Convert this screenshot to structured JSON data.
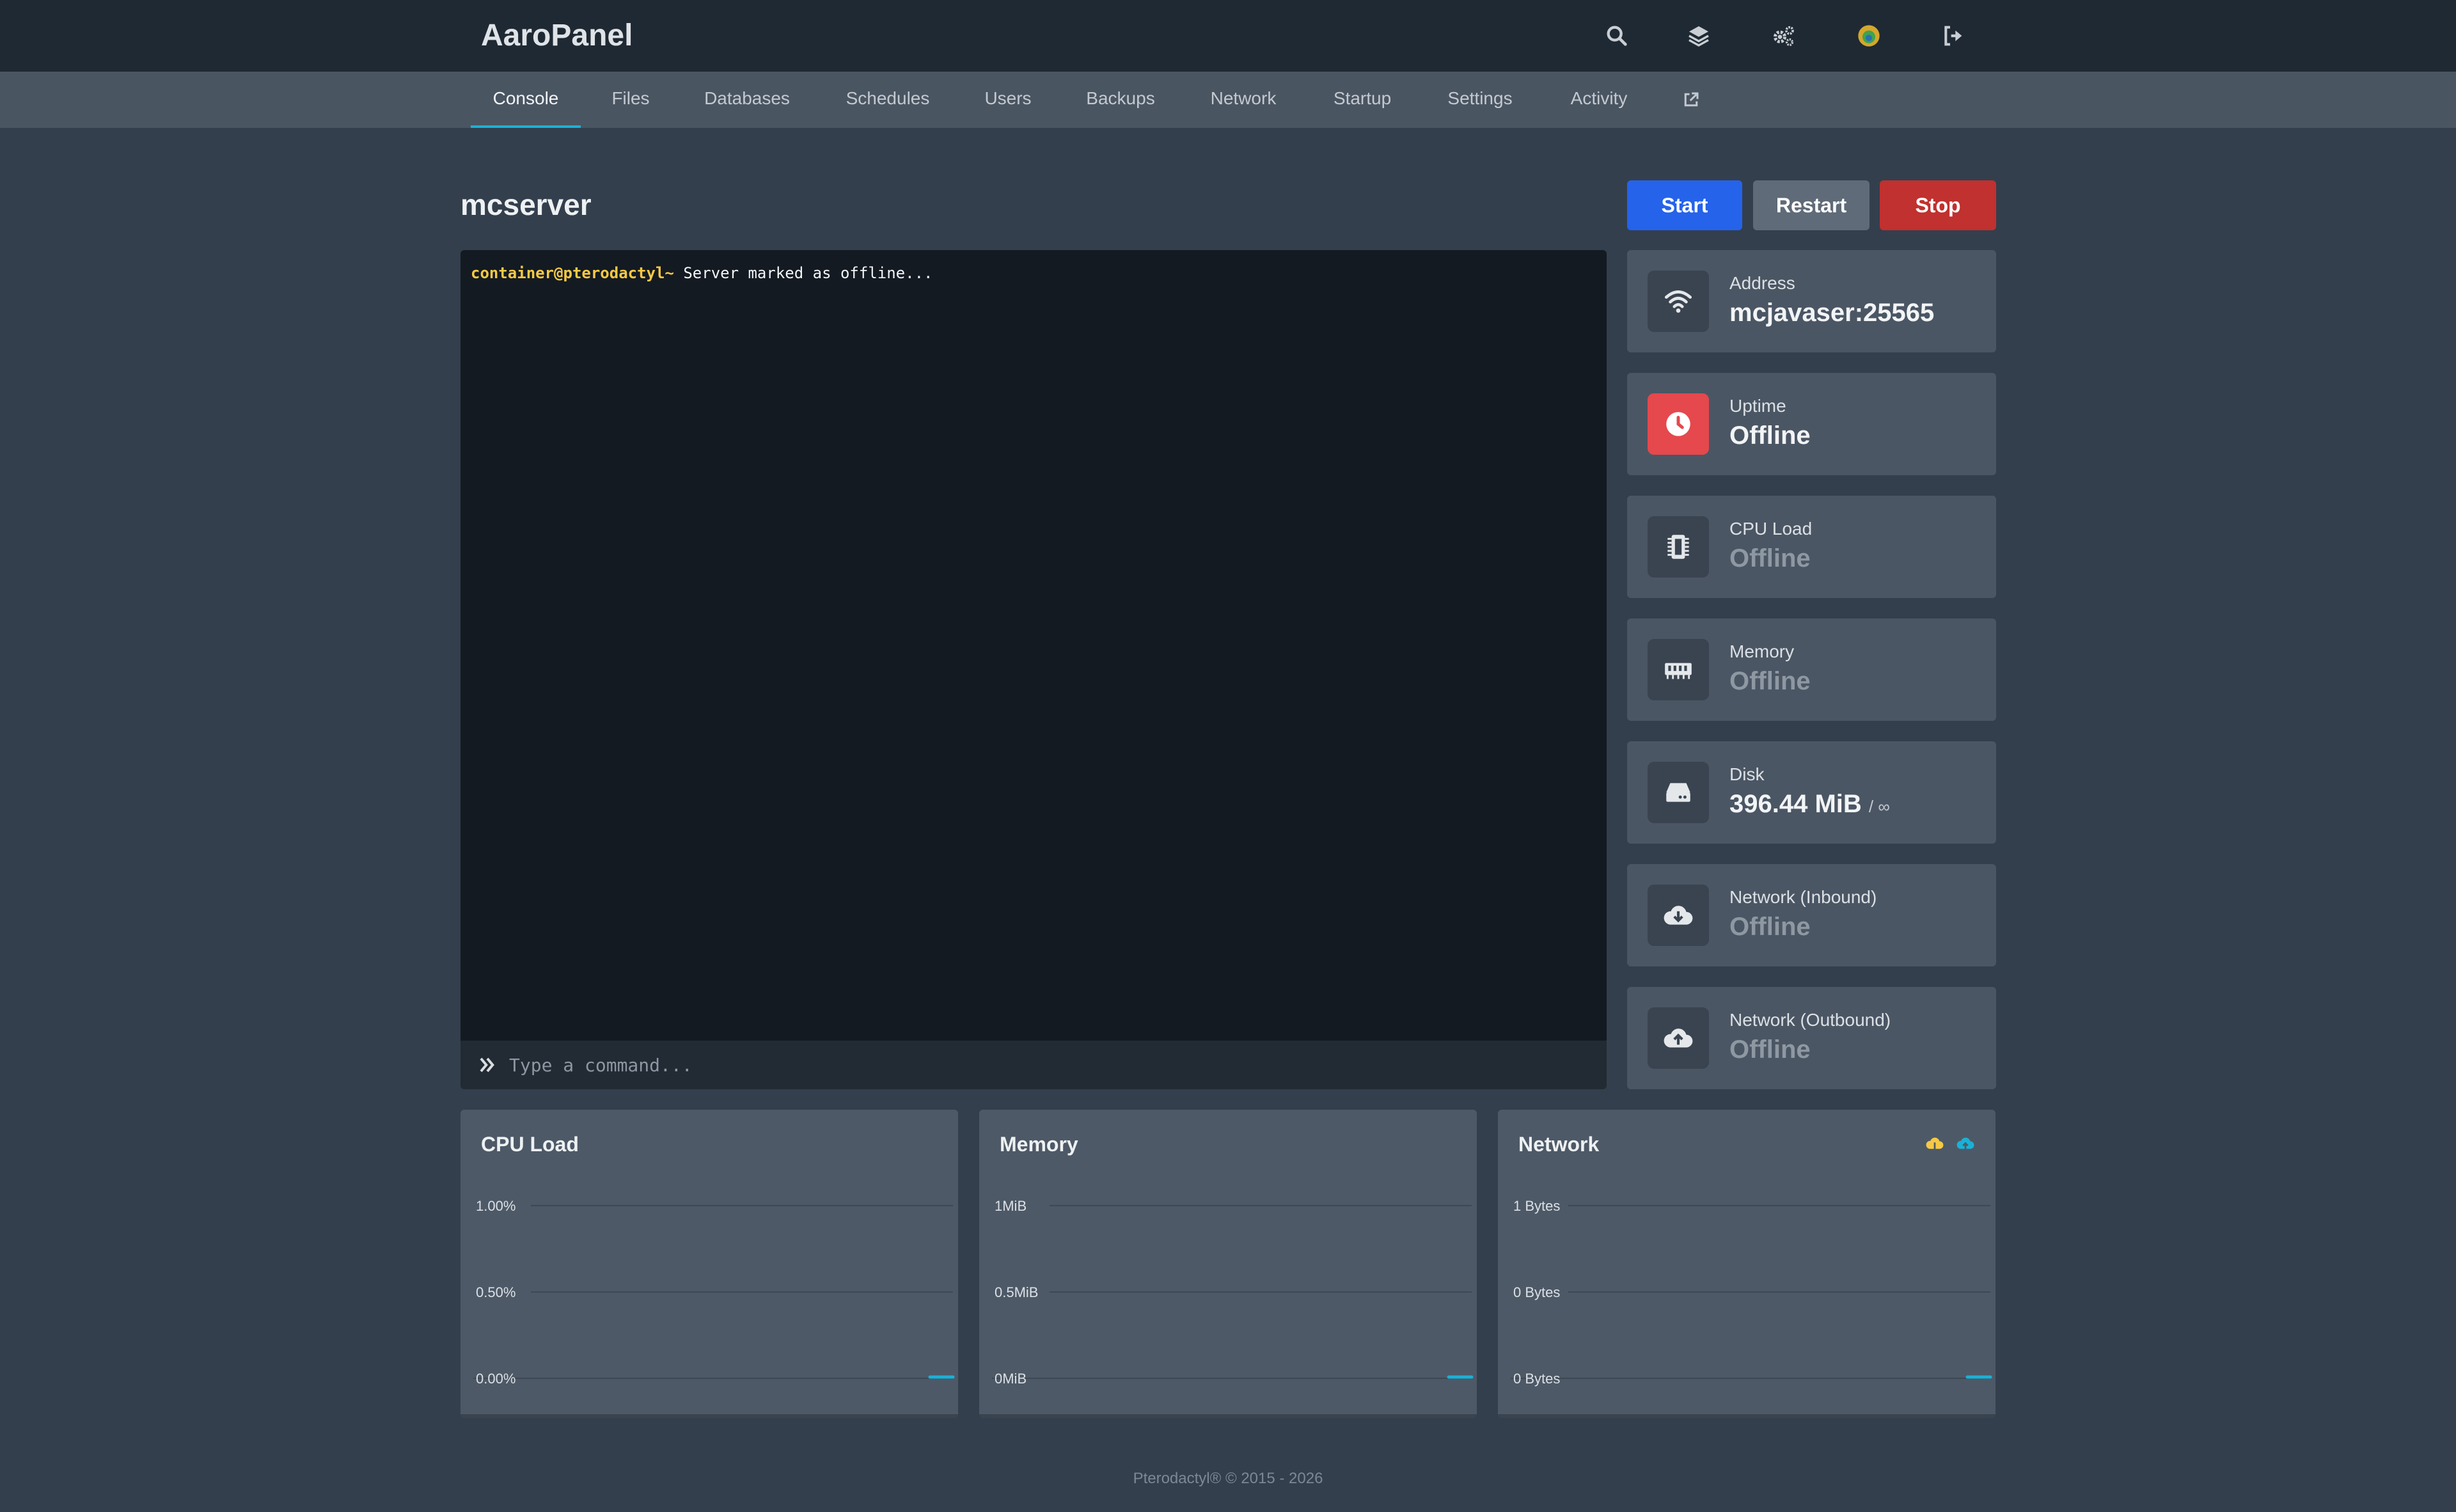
{
  "app": {
    "brand": "AaroPanel"
  },
  "topbar": {
    "icons": [
      "search-icon",
      "layers-icon",
      "cogs-icon",
      "avatar",
      "sign-out-icon"
    ]
  },
  "tabs": [
    {
      "label": "Console",
      "active": true
    },
    {
      "label": "Files"
    },
    {
      "label": "Databases"
    },
    {
      "label": "Schedules"
    },
    {
      "label": "Users"
    },
    {
      "label": "Backups"
    },
    {
      "label": "Network"
    },
    {
      "label": "Startup"
    },
    {
      "label": "Settings"
    },
    {
      "label": "Activity"
    }
  ],
  "server": {
    "name": "mcserver"
  },
  "controls": {
    "start": "Start",
    "restart": "Restart",
    "stop": "Stop"
  },
  "console": {
    "prompt": "container@pterodactyl~",
    "message": " Server marked as offline...",
    "placeholder": "Type a command..."
  },
  "stats": [
    {
      "label": "Address",
      "value": "mcjavaser:25565",
      "muted": false,
      "icon": "wifi-icon"
    },
    {
      "label": "Uptime",
      "value": "Offline",
      "muted": false,
      "icon": "clock-icon",
      "accent": "#e5484d"
    },
    {
      "label": "CPU Load",
      "value": "Offline",
      "muted": true,
      "icon": "microchip-icon"
    },
    {
      "label": "Memory",
      "value": "Offline",
      "muted": true,
      "icon": "memory-icon"
    },
    {
      "label": "Disk",
      "value": "396.44 MiB",
      "sub": "/ ∞",
      "muted": false,
      "icon": "hdd-icon"
    },
    {
      "label": "Network (Inbound)",
      "value": "Offline",
      "muted": true,
      "icon": "cloud-download-icon"
    },
    {
      "label": "Network (Outbound)",
      "value": "Offline",
      "muted": true,
      "icon": "cloud-upload-icon"
    }
  ],
  "chart_data": [
    {
      "type": "line",
      "title": "CPU Load",
      "yticks": [
        "1.00%",
        "0.50%",
        "0.00%"
      ],
      "ylim": [
        0,
        1
      ],
      "series": [
        {
          "values": [
            0,
            0
          ]
        }
      ]
    },
    {
      "type": "line",
      "title": "Memory",
      "yticks": [
        "1MiB",
        "0.5MiB",
        "0MiB"
      ],
      "ylim": [
        0,
        1
      ],
      "series": [
        {
          "values": [
            0,
            0
          ]
        }
      ]
    },
    {
      "type": "line",
      "title": "Network",
      "yticks": [
        "1 Bytes",
        "0 Bytes",
        "0 Bytes"
      ],
      "ylim": [
        0,
        1
      ],
      "series": [
        {
          "values": [
            0,
            0
          ]
        }
      ],
      "legend_icons": [
        {
          "icon": "cloud-download-icon",
          "color": "#f6c944"
        },
        {
          "icon": "cloud-upload-icon",
          "color": "#1ab1d6"
        }
      ]
    }
  ],
  "colors": {
    "accent": "#1ab1d6",
    "start": "#2563eb",
    "stop": "#c0312f"
  },
  "footer": "Pterodactyl® © 2015 - 2026"
}
